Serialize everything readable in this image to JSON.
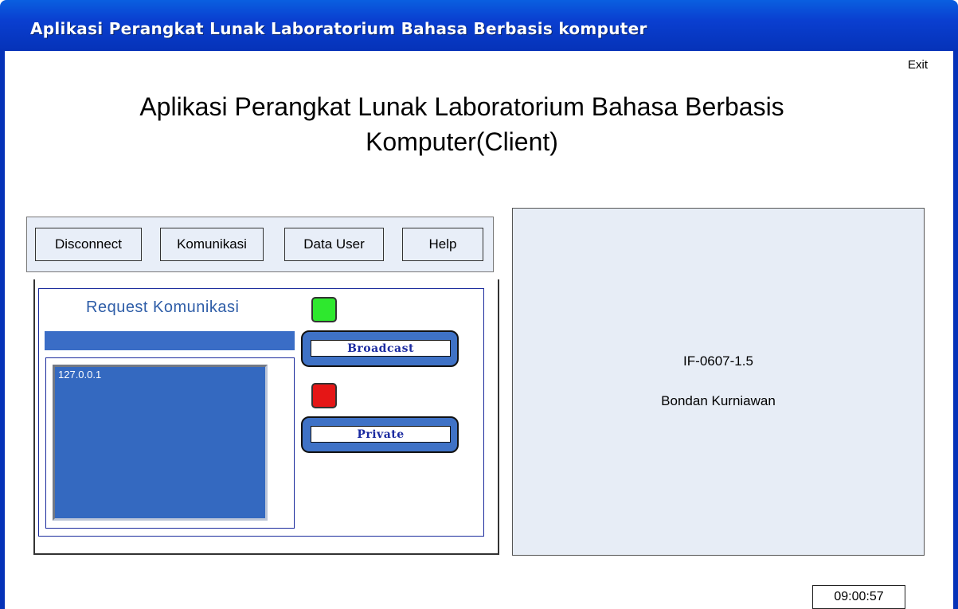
{
  "window": {
    "title": "Aplikasi Perangkat Lunak Laboratorium Bahasa Berbasis komputer"
  },
  "header": {
    "exit_label": "Exit",
    "app_title_line1": "Aplikasi Perangkat Lunak Laboratorium Bahasa Berbasis",
    "app_title_line2": "Komputer(Client)"
  },
  "menu": {
    "disconnect": "Disconnect",
    "komunikasi": "Komunikasi",
    "data_user": "Data User",
    "help": "Help"
  },
  "request_panel": {
    "title": "Request Komunikasi",
    "clients": [
      "127.0.0.1"
    ],
    "broadcast_label": "Broadcast",
    "private_label": "Private",
    "status_colors": {
      "broadcast": "#2ee82e",
      "private": "#e51616"
    }
  },
  "info_panel": {
    "line1": "IF-0607-1.5",
    "line2": "Bondan Kurniawan"
  },
  "clock": {
    "time": "09:00:57"
  }
}
